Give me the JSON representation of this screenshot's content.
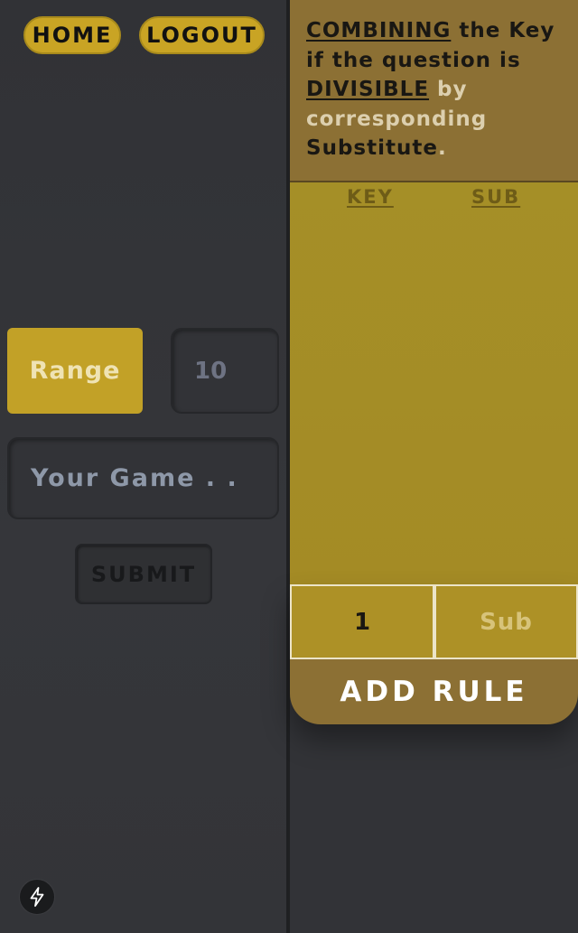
{
  "nav": {
    "home_label": "HOME",
    "logout_label": "LOGOUT"
  },
  "game_form": {
    "range_label": "Range",
    "range_value": "10",
    "game_placeholder": "Your Game . .",
    "submit_label": "SUBMIT"
  },
  "rule_info": {
    "word1": "COMBINING",
    "text1": " the Key if the question is ",
    "word2": "DIVISIBLE",
    "text2": " by corresponding ",
    "word3": "Substitute",
    "period": "."
  },
  "rules_table": {
    "key_header": "KEY",
    "sub_header": "SUB"
  },
  "new_rule": {
    "key_value": "1",
    "sub_placeholder": "Sub",
    "add_label": "ADD RULE"
  },
  "icons": {
    "bolt": "lightning-bolt-icon"
  },
  "colors": {
    "accent_gold": "#c9a424",
    "panel_brown": "#8c7034",
    "table_olive": "#a58f27",
    "background": "#333438"
  }
}
